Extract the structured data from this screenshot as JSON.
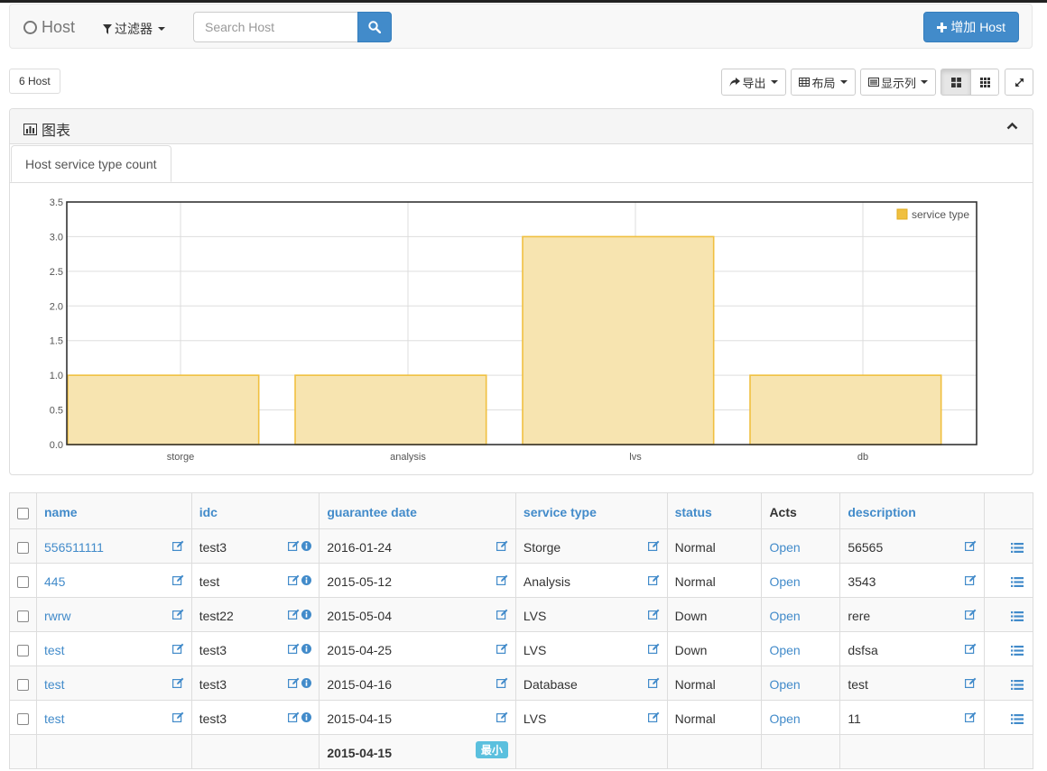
{
  "navbar": {
    "brand": "Host",
    "filter_label": "过滤器",
    "search_placeholder": "Search Host",
    "add_label": "增加 Host"
  },
  "toolbar": {
    "count": "6 Host",
    "export_label": "导出",
    "layout_label": "布局",
    "columns_label": "显示列"
  },
  "chart_panel": {
    "title": "图表",
    "tab": "Host service type count"
  },
  "chart_data": {
    "type": "bar",
    "categories": [
      "storge",
      "analysis",
      "lvs",
      "db"
    ],
    "series": [
      {
        "name": "service type",
        "values": [
          1,
          1,
          3,
          1
        ]
      }
    ],
    "ylim": [
      0,
      3.5
    ],
    "yticks": [
      "0.0",
      "0.5",
      "1.0",
      "1.5",
      "2.0",
      "2.5",
      "3.0",
      "3.5"
    ],
    "legend": "top-right",
    "grid": true,
    "bar_fill": "#f7e4b0",
    "bar_stroke": "#f0c040"
  },
  "table": {
    "headers": {
      "name": "name",
      "idc": "idc",
      "guarantee": "guarantee date",
      "service": "service type",
      "status": "status",
      "acts": "Acts",
      "description": "description"
    },
    "rows": [
      {
        "name": "556511111",
        "idc": "test3",
        "date": "2016-01-24",
        "service": "Storge",
        "status": "Normal",
        "acts": "Open",
        "description": "56565"
      },
      {
        "name": "445",
        "idc": "test",
        "date": "2015-05-12",
        "service": "Analysis",
        "status": "Normal",
        "acts": "Open",
        "description": "3543"
      },
      {
        "name": "rwrw",
        "idc": "test22",
        "date": "2015-05-04",
        "service": "LVS",
        "status": "Down",
        "acts": "Open",
        "description": "rere"
      },
      {
        "name": "test",
        "idc": "test3",
        "date": "2015-04-25",
        "service": "LVS",
        "status": "Down",
        "acts": "Open",
        "description": "dsfsa"
      },
      {
        "name": "test",
        "idc": "test3",
        "date": "2015-04-16",
        "service": "Database",
        "status": "Normal",
        "acts": "Open",
        "description": "test"
      },
      {
        "name": "test",
        "idc": "test3",
        "date": "2015-04-15",
        "service": "LVS",
        "status": "Normal",
        "acts": "Open",
        "description": "11"
      }
    ],
    "footer": {
      "date": "2015-04-15",
      "badge": "最小"
    }
  },
  "colors": {
    "primary": "#428bca",
    "info": "#5bc0de"
  }
}
